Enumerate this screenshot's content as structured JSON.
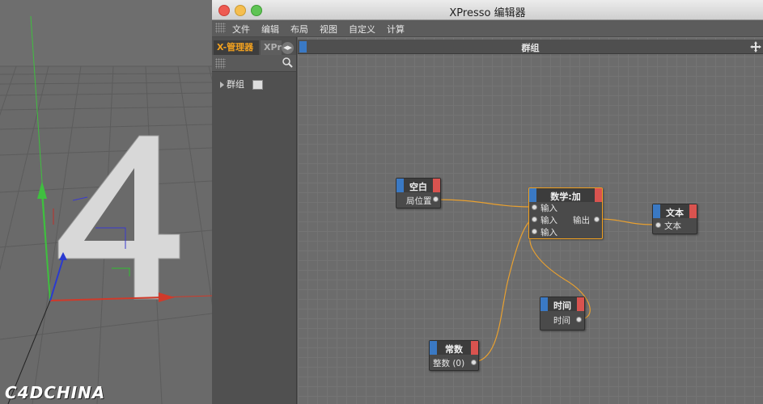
{
  "window": {
    "title": "XPresso 编辑器"
  },
  "menu": [
    "文件",
    "编辑",
    "布局",
    "视图",
    "自定义",
    "计算"
  ],
  "left_panel": {
    "tabs": [
      "X-管理器",
      "XPr"
    ],
    "tree": [
      {
        "label": "群组"
      }
    ]
  },
  "editor": {
    "title": "群组",
    "nodes": {
      "null": {
        "title": "空白",
        "outputs": [
          "局位置"
        ]
      },
      "math": {
        "title": "数学:加",
        "inputs": [
          "输入",
          "输入",
          "输入"
        ],
        "output": "输出"
      },
      "text": {
        "title": "文本",
        "inputs": [
          "文本"
        ]
      },
      "time": {
        "title": "时间",
        "outputs": [
          "时间"
        ]
      },
      "const": {
        "title": "常数",
        "outputs": [
          "整数 (0)"
        ]
      }
    }
  },
  "viewport": {
    "watermark": "C4DCHINA",
    "digit": "4"
  },
  "colors": {
    "accent": "#f0a020",
    "port_blue": "#3a79c4",
    "port_red": "#d9534f",
    "wire": "#e8a030"
  }
}
